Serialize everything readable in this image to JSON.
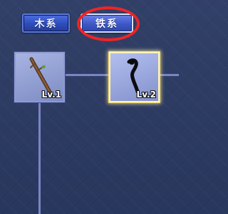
{
  "tabs": [
    {
      "label": "木系",
      "selected": false
    },
    {
      "label": "铁系",
      "selected": true
    }
  ],
  "items": [
    {
      "level": "Lv.1",
      "icon": "wooden-branch-icon"
    },
    {
      "level": "Lv.2",
      "icon": "iron-staff-icon"
    }
  ],
  "colors": {
    "background": "#2b3a63",
    "tab_blue": "#3d58c8",
    "annotation_red": "#ee2525",
    "selected_glow": "#f3d86d",
    "connector": "#7b84c4"
  }
}
